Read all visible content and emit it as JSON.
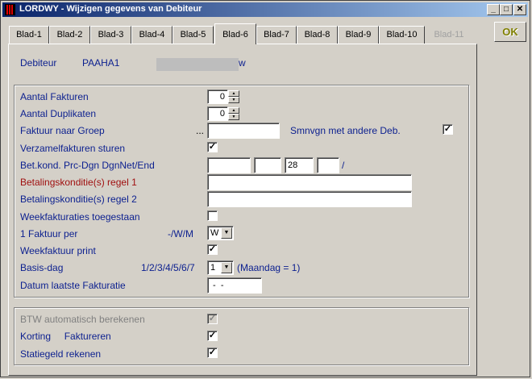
{
  "window": {
    "title": "LORDWY - Wijzigen gegevens van Debiteur",
    "minimize": "_",
    "maximize": "□",
    "close": "✕"
  },
  "tabs": [
    "Blad-1",
    "Blad-2",
    "Blad-3",
    "Blad-4",
    "Blad-5",
    "Blad-6",
    "Blad-7",
    "Blad-8",
    "Blad-9",
    "Blad-10",
    "Blad-11"
  ],
  "active_tab": "Blad-6",
  "ok_label": "OK",
  "header": {
    "debiteur_label": "Debiteur",
    "debiteur_code": "PAAHA1",
    "trailing_char": "w"
  },
  "form": {
    "aantal_fakturen_label": "Aantal Fakturen",
    "aantal_fakturen_value": "0",
    "aantal_duplikaten_label": "Aantal Duplikaten",
    "aantal_duplikaten_value": "0",
    "faktuur_groep_label": "Faktuur naar Groep",
    "faktuur_groep_dots": "...",
    "faktuur_groep_value": "",
    "smnvgn_label": "Smnvgn met andere Deb.",
    "smnvgn_checked": true,
    "verzamel_label": "Verzamelfakturen sturen",
    "verzamel_checked": true,
    "betkond_label": "Bet.kond. Prc-Dgn DgnNet/End",
    "betkond_values": [
      "",
      "",
      "28",
      ""
    ],
    "betkond_slash": "/",
    "regel1_label": "Betalingskonditie(s) regel 1",
    "regel1_value": "",
    "regel2_label": "Betalingskonditie(s) regel 2",
    "regel2_value": "",
    "weekfakt_label": "Weekfakturaties toegestaan",
    "weekfakt_checked": false,
    "faktuur_per_label": "1 Faktuur per",
    "faktuur_per_hint": "-/W/M",
    "faktuur_per_value": "W",
    "weekfaktuur_print_label": "Weekfaktuur print",
    "weekfaktuur_print_checked": true,
    "basis_dag_label": "Basis-dag",
    "basis_dag_hint": "1/2/3/4/5/6/7",
    "basis_dag_value": "1",
    "basis_dag_note": "(Maandag  =  1)",
    "datum_label": "Datum laatste Fakturatie",
    "datum_value": " -  -"
  },
  "form2": {
    "btw_label": "BTW automatisch berekenen",
    "btw_checked": true,
    "korting_label": "Korting     Faktureren",
    "korting_checked": true,
    "statiegeld_label": "Statiegeld rekenen",
    "statiegeld_checked": true
  },
  "check_glyph": "✓"
}
